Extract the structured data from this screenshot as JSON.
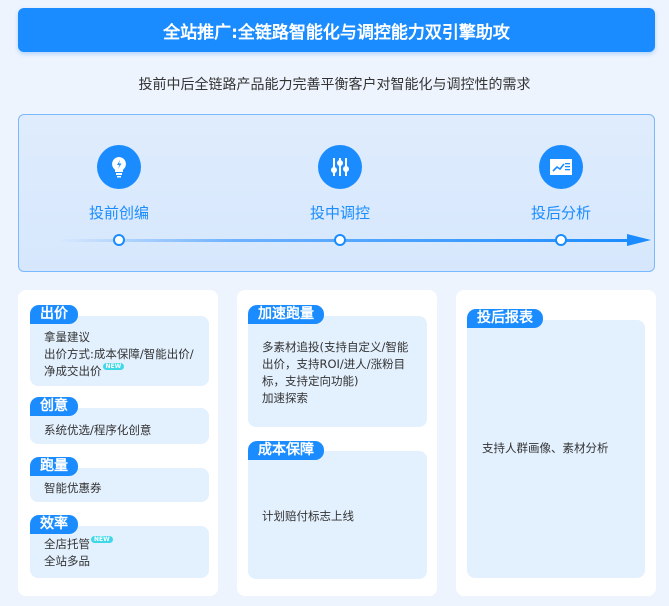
{
  "title": "全站推广:全链路智能化与调控能力双引擎助攻",
  "subtitle": "投前中后全链路产品能力完善平衡客户对智能化与调控性的需求",
  "steps": [
    {
      "label": "投前创编",
      "icon": "lightbulb-icon"
    },
    {
      "label": "投中调控",
      "icon": "sliders-icon"
    },
    {
      "label": "投后分析",
      "icon": "chart-report-icon"
    }
  ],
  "columns": [
    {
      "sections": [
        {
          "tag": "出价",
          "lines": [
            "拿量建议",
            "出价方式:成本保障/智能出价/",
            "净成交出价"
          ],
          "badge": "NEW"
        },
        {
          "tag": "创意",
          "lines": [
            "系统优选/程序化创意"
          ]
        },
        {
          "tag": "跑量",
          "lines": [
            "智能优惠券"
          ]
        },
        {
          "tag": "效率",
          "lines": [
            "全店托管",
            "全站多品"
          ],
          "badge": "NEW"
        }
      ]
    },
    {
      "sections": [
        {
          "tag": "加速跑量",
          "lines": [
            "多素材追投(支持自定义/智能出价，支持ROI/进人/涨粉目标，支持定向功能)",
            "加速探索"
          ]
        },
        {
          "tag": "成本保障",
          "lines": [
            "计划赔付标志上线"
          ]
        }
      ]
    },
    {
      "sections": [
        {
          "tag": "投后报表",
          "lines": [
            "支持人群画像、素材分析"
          ]
        }
      ]
    }
  ],
  "colors": {
    "primary": "#1a8cff",
    "box": "#e3f0fe",
    "bg": "#eef4fe",
    "new": "#3fd8e8"
  }
}
